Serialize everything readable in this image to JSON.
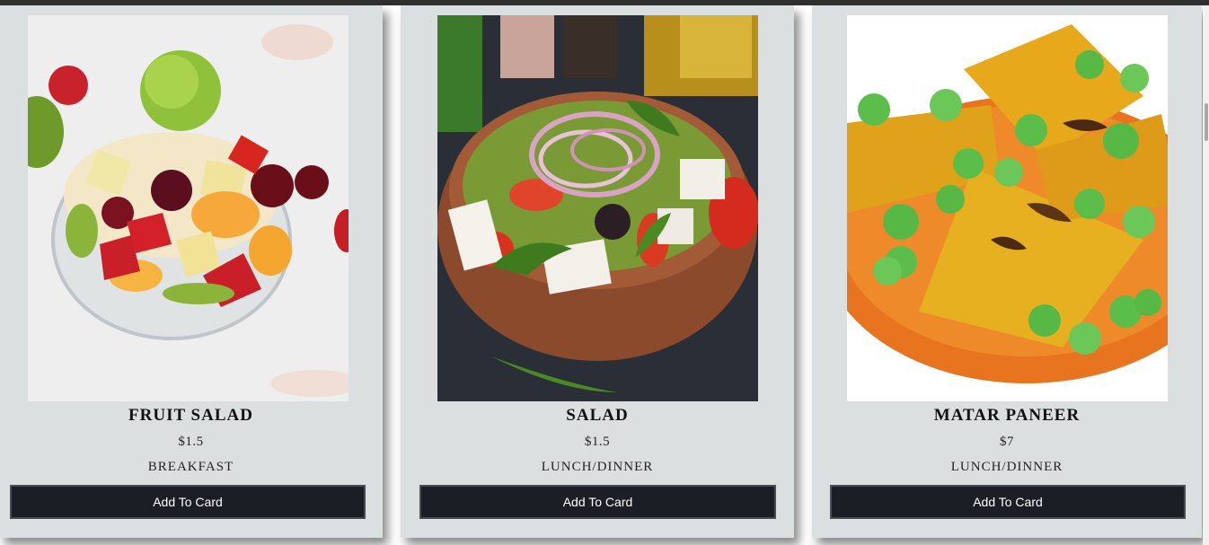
{
  "products": [
    {
      "name": "FRUIT SALAD",
      "price": "$1.5",
      "category": "BREAKFAST",
      "button": "Add To Card",
      "image": "fruit-salad-photo"
    },
    {
      "name": "SALAD",
      "price": "$1.5",
      "category": "LUNCH/DINNER",
      "button": "Add To Card",
      "image": "greek-salad-photo"
    },
    {
      "name": "MATAR PANEER",
      "price": "$7",
      "category": "LUNCH/DINNER",
      "button": "Add To Card",
      "image": "matar-paneer-photo"
    }
  ],
  "colors": {
    "card_bg": "#dcdfe0",
    "button_bg": "#1b1e24",
    "button_text": "#ffffff"
  }
}
